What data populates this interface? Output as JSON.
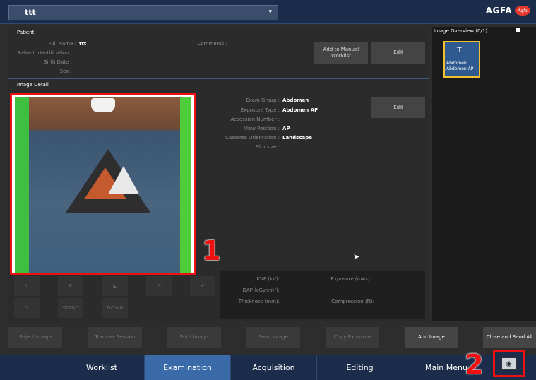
{
  "topbar": {
    "patient_value": "ttt",
    "caret": "▾",
    "brand": "AGFA",
    "brand_logo": "Agfa"
  },
  "patient": {
    "section_label": "Patient",
    "full_name_label": "Full Name :",
    "full_name_value": "ttt",
    "patient_id_label": "Patient Identification :",
    "birth_date_label": "Birth Date :",
    "sex_label": "Sex :",
    "comments_label": "Comments :",
    "add_manual_worklist": "Add to Manual Worklist",
    "edit": "Edit"
  },
  "detail": {
    "section_label": "Image Detail",
    "exam_group_label": "Exam Group :",
    "exam_group_value": "Abdomen",
    "exposure_type_label": "Exposure Type :",
    "exposure_type_value": "Abdomen AP",
    "accession_label": "Accession Number :",
    "view_position_label": "View Position :",
    "view_position_value": "AP",
    "cassette_label": "Cassette Orientation :",
    "cassette_value": "Landscape",
    "film_size_label": "Film size :",
    "edit": "Edit"
  },
  "params": {
    "kvp": "KVP (kV):",
    "exposure": "Exposure (mAs):",
    "dap": "DAP (cGy.cm²):",
    "thickness": "Thickness (mm):",
    "compression": "Compression (N):"
  },
  "tools": {
    "l": "L",
    "r": "R",
    "stand": "STAND",
    "down": "DOWN"
  },
  "overview": {
    "title": "Image Overview (0/1)",
    "thumb_line1": "Abdomen",
    "thumb_line2": "Abdomen AP"
  },
  "actions": {
    "reject": "Reject Image",
    "transfer": "Transfer Session",
    "print": "Print Image",
    "send": "Send Image",
    "copy": "Copy Exposure",
    "add": "Add Image",
    "close_send": "Close and Send All"
  },
  "nav": {
    "worklist": "Worklist",
    "examination": "Examination",
    "acquisition": "Acquisition",
    "editing": "Editing",
    "main_menu": "Main Menu"
  },
  "annotations": {
    "one": "1",
    "two": "2"
  },
  "colors": {
    "nav_bg": "#1b2d4a",
    "nav_active": "#3a6aa8",
    "highlight": "#e11",
    "thumb_border": "#f0c030"
  },
  "icons": [
    "caret-down-icon",
    "agfa-logo-icon",
    "detector-icon",
    "rotate-right-icon",
    "undo-icon",
    "crop-icon",
    "system-icon",
    "mouse-cursor-icon"
  ]
}
